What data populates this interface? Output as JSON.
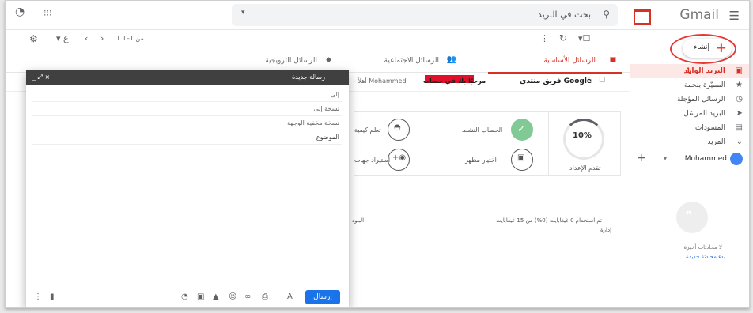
{
  "header": {
    "logo_text": "Gmail",
    "search_placeholder": "بحث في البريد",
    "apps_icon": "apps-grid-icon"
  },
  "toolbar": {
    "pagination": "1 من 1–1"
  },
  "sidebar": {
    "compose_label": "إنشاء",
    "items": [
      {
        "label": "البريد الوارد",
        "count": "1",
        "icon": "inbox-icon"
      },
      {
        "label": "المميّزة بنجمة",
        "count": "",
        "icon": "star-icon"
      },
      {
        "label": "الرسائل المؤجلة",
        "count": "",
        "icon": "clock-icon"
      },
      {
        "label": "البريد المرسَل",
        "count": "",
        "icon": "send-icon"
      },
      {
        "label": "المسودات",
        "count": "",
        "icon": "draft-icon"
      },
      {
        "label": "المزيد",
        "count": "",
        "icon": "chevron-down-icon"
      }
    ],
    "account_name": "Mohammed",
    "no_chats": "لا محادثات أخيرة",
    "start_chat": "بدء محادثة جديدة"
  },
  "tabs": [
    {
      "label": "الرسائل الأساسية"
    },
    {
      "label": "الرسائل الاجتماعية"
    },
    {
      "label": "الرسائل الترويجية"
    }
  ],
  "email_row": {
    "sender": "فريق منتدى Google",
    "subject": "مرحبًا بك في حساب",
    "snippet": "- أهلاً Mohammed"
  },
  "setup": {
    "progress_text": "10%",
    "progress_value": 10,
    "progress_label": "تقدم الإعداد",
    "item1": "الحساب النشط",
    "item2": "تعلم كيفية",
    "item3": "اختيار مظهر",
    "item4": "استيراد جهات"
  },
  "footer": {
    "storage": "تم استخدام 0 غيغابايت (0%) من 15 غيغابايت",
    "manage": "إدارة",
    "terms": "البنود"
  },
  "compose": {
    "title": "رسالة جديدة",
    "to": "إلى",
    "cc": "نسخة إلى",
    "bcc": "نسخة مخفية الوجهة",
    "subject": "الموضوع",
    "send": "إرسال",
    "controls": "_ ⤢ ×"
  }
}
